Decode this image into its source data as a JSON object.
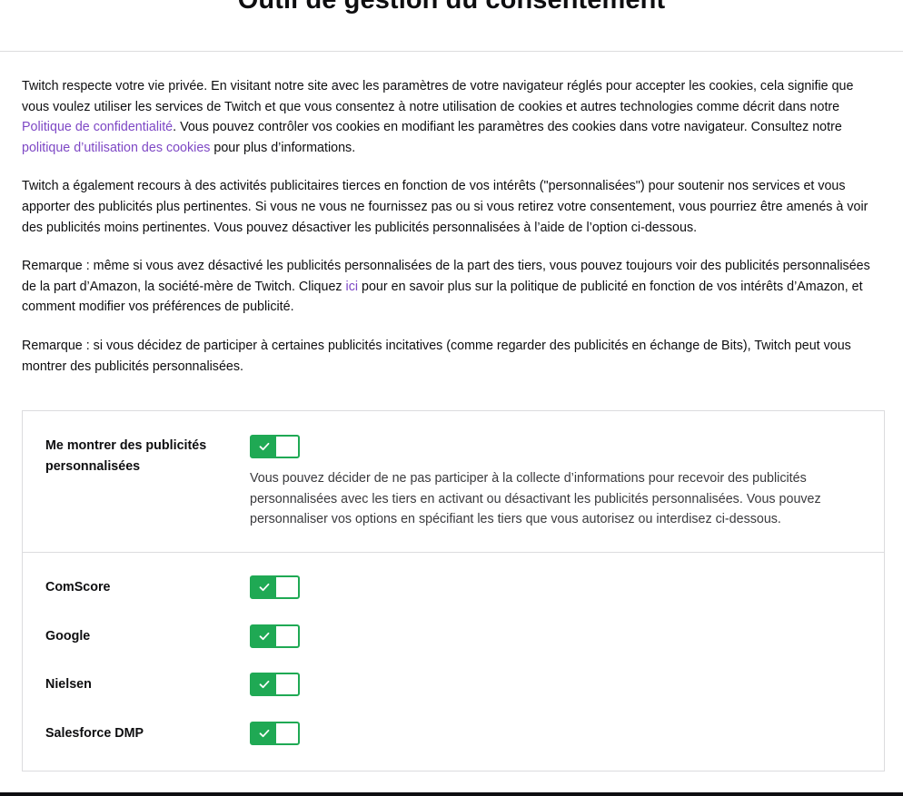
{
  "header": {
    "title": "Outil de gestion du consentement"
  },
  "intro": {
    "p1_part1": "Twitch respecte votre vie privée. En visitant notre site avec les paramètres de votre navigateur réglés pour accepter les cookies, cela signifie que vous voulez utiliser les services de Twitch et que vous consentez à notre utilisation de cookies et autres technologies comme décrit dans notre ",
    "p1_link1": "Politique de confidentialité",
    "p1_part2": ". Vous pouvez contrôler vos cookies en modifiant les paramètres des cookies dans votre navigateur. Consultez notre ",
    "p1_link2": "politique d’utilisation des cookies",
    "p1_part3": " pour plus d’informations.",
    "p2": "Twitch a également recours à des activités publicitaires tierces en fonction de vos intérêts (\"personnalisées\") pour soutenir nos services et vous apporter des publicités plus pertinentes. Si vous ne vous ne fournissez pas ou si vous retirez votre consentement, vous pourriez être amenés à voir des publicités moins pertinentes. Vous pouvez désactiver les publicités personnalisées à l’aide de l’option ci-dessous.",
    "p3_part1": "Remarque : même si vous avez désactivé les publicités personnalisées de la part des tiers, vous pouvez toujours voir des publicités personnalisées de la part d’Amazon, la société-mère de Twitch. Cliquez ",
    "p3_link": "ici",
    "p3_part2": " pour en savoir plus sur la politique de publicité en fonction de vos intérêts d’Amazon, et comment modifier vos préférences de publicité.",
    "p4": "Remarque : si vous décidez de participer à certaines publicités incitatives (comme regarder des publicités en échange de Bits), Twitch peut vous montrer des publicités personnalisées."
  },
  "consent": {
    "master_label": "Me montrer des publicités personnalisées",
    "master_on": true,
    "master_desc": "Vous pouvez décider de ne pas participer à la collecte d’informations pour recevoir des publicités personnalisées avec les tiers en activant ou désactivant les publicités personnalisées. Vous pouvez personnaliser vos options en spécifiant les tiers que vous autorisez ou interdisez ci-dessous.",
    "vendors": [
      {
        "name": "ComScore",
        "on": true
      },
      {
        "name": "Google",
        "on": true
      },
      {
        "name": "Nielsen",
        "on": true
      },
      {
        "name": "Salesforce DMP",
        "on": true
      }
    ]
  },
  "colors": {
    "accent": "#1fa954",
    "link": "#7e48c5"
  },
  "icons": {
    "toggle_on": "checkmark-icon"
  }
}
